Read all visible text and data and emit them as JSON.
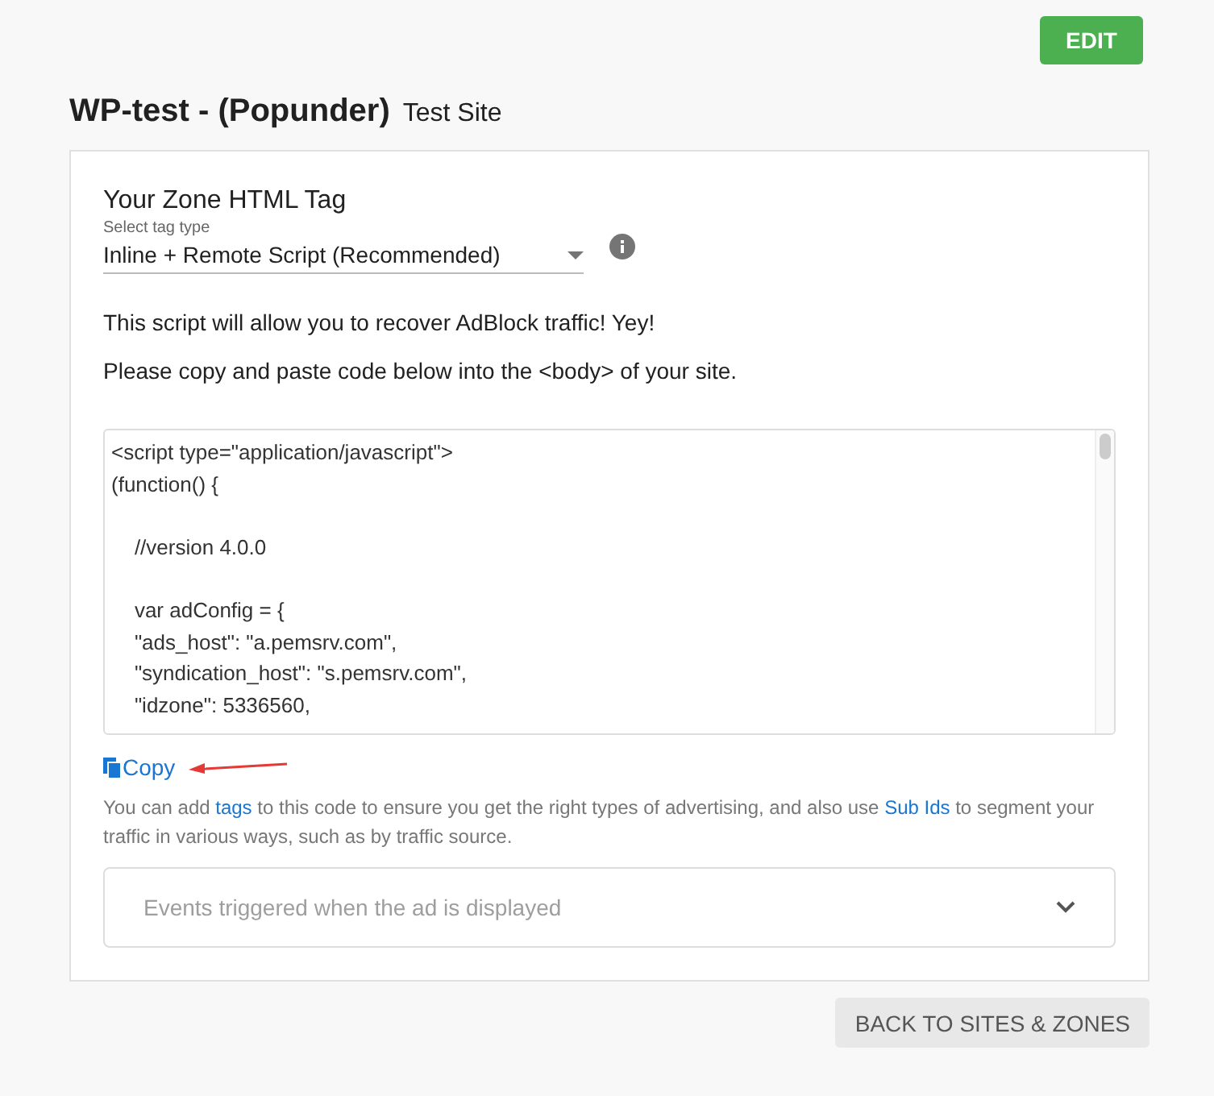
{
  "edit_button": "EDIT",
  "title": "WP-test - (Popunder)",
  "subtitle": "Test Site",
  "section_title": "Your Zone HTML Tag",
  "tag_select": {
    "label": "Select tag type",
    "value": "Inline + Remote Script (Recommended)"
  },
  "notes": [
    "This script will allow you to recover AdBlock traffic! Yey!",
    "Please copy and paste code below into the <body> of your site."
  ],
  "code": "<script type=\"application/javascript\">\n(function() {\n\n    //version 4.0.0\n\n    var adConfig = {\n    \"ads_host\": \"a.pemsrv.com\",\n    \"syndication_host\": \"s.pemsrv.com\",\n    \"idzone\": 5336560,",
  "copy_link": "Copy",
  "help": [
    {
      "kind": "text",
      "text": "You can add "
    },
    {
      "kind": "link",
      "text": "tags"
    },
    {
      "kind": "text",
      "text": " to this code to ensure you get the right types of advertising, and also use "
    },
    {
      "kind": "link",
      "text": "Sub Ids"
    },
    {
      "kind": "text",
      "text": " to segment your traffic in various ways, such as by traffic source."
    }
  ],
  "events_panel": {
    "title": "Events triggered when the ad is displayed",
    "expanded": false
  },
  "back_button": "BACK TO SITES & ZONES"
}
